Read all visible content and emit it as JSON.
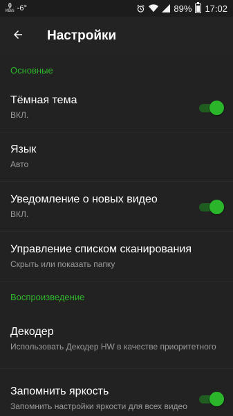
{
  "status_bar": {
    "net_speed": "0",
    "net_unit": "KB/s",
    "temperature": "-6°",
    "battery_percent": "89%",
    "battery_level": 0.89,
    "time": "17:02"
  },
  "app_bar": {
    "title": "Настройки",
    "back_icon": "arrow-back-icon"
  },
  "colors": {
    "accent": "#2fb52c",
    "background": "#222222",
    "summary_text": "#9a9a9a"
  },
  "sections": {
    "main": {
      "header": "Основные",
      "dark_theme": {
        "title": "Тёмная тема",
        "summary": "ВКЛ.",
        "enabled": true
      },
      "language": {
        "title": "Язык",
        "summary": "Авто"
      },
      "new_video_notification": {
        "title": "Уведомление о новых видео",
        "summary": "ВКЛ.",
        "enabled": true
      },
      "scan_list": {
        "title": "Управление списком сканирования",
        "summary": "Скрыть или показать папку"
      }
    },
    "playback": {
      "header": "Воспроизведение",
      "decoder": {
        "title": "Декодер",
        "summary": "Использовать Декодер HW в качестве приоритетного"
      },
      "remember_brightness": {
        "title": "Запомнить яркость",
        "summary": "Запомнить настройки яркости для всех видео",
        "enabled": true
      }
    }
  }
}
